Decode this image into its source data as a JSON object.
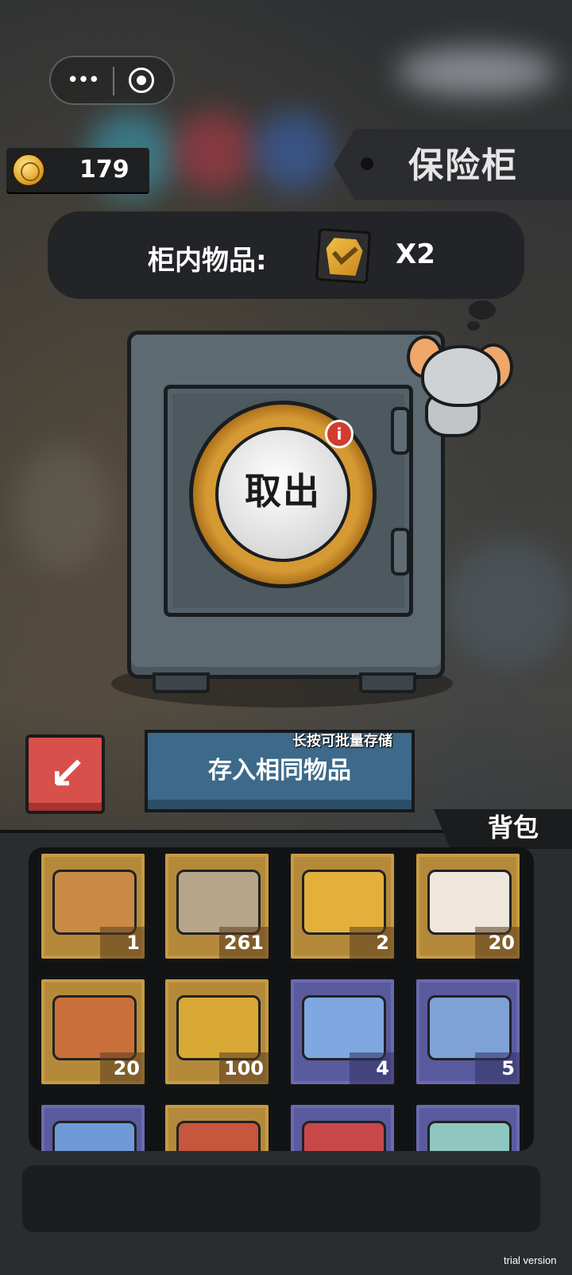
{
  "capsule": {
    "menu_icon": "more-dots-icon",
    "close_icon": "target-icon"
  },
  "currency": {
    "icon": "coin-icon",
    "amount": "179"
  },
  "title": "保险柜",
  "safe_contents": {
    "label": "柜内物品:",
    "item_icon": "gold-card-icon",
    "count": "X2"
  },
  "safe": {
    "dial_label": "取出",
    "info_icon": "info-icon",
    "info_glyph": "i"
  },
  "actions": {
    "swap_icon": "swap-arrow-icon",
    "swap_glyph": "↙",
    "store_hint": "长按可批量存储",
    "store_label": "存入相同物品"
  },
  "backpack": {
    "tab_label": "背包",
    "items": [
      {
        "name": "capybara-pack",
        "count": "1",
        "rarity": "gold",
        "color": "#c98a45"
      },
      {
        "name": "film-reel",
        "count": "261",
        "rarity": "gold",
        "color": "#b7a58a"
      },
      {
        "name": "gold-card",
        "count": "2",
        "rarity": "gold",
        "color": "#e3b03c"
      },
      {
        "name": "medical-card",
        "count": "20",
        "rarity": "gold",
        "color": "#efe6dc"
      },
      {
        "name": "steak-pack",
        "count": "20",
        "rarity": "gold",
        "color": "#c9703a"
      },
      {
        "name": "golden-ticket",
        "count": "100",
        "rarity": "gold",
        "color": "#d9a936"
      },
      {
        "name": "toy-ticket",
        "count": "4",
        "rarity": "purple",
        "color": "#7fa8e0"
      },
      {
        "name": "blue-ticket",
        "count": "5",
        "rarity": "purple",
        "color": "#7fa2d6"
      },
      {
        "name": "blue-item",
        "count": "",
        "rarity": "purple",
        "color": "#6f9ad6"
      },
      {
        "name": "bottle",
        "count": "",
        "rarity": "gold",
        "color": "#c6563c"
      },
      {
        "name": "first-aid-kit",
        "count": "",
        "rarity": "purple",
        "color": "#c8484a"
      },
      {
        "name": "teal-pack",
        "count": "",
        "rarity": "purple",
        "color": "#8fc6c0"
      }
    ]
  },
  "footer": {
    "trial_label": "trial version"
  }
}
